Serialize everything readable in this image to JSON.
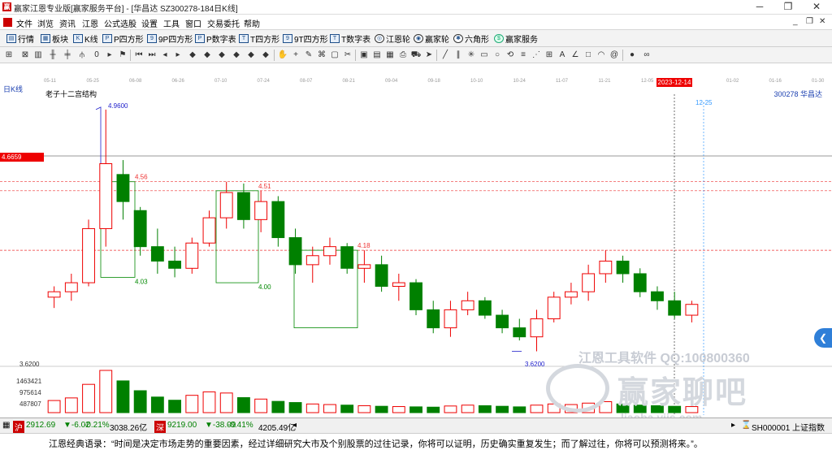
{
  "window": {
    "title": "赢家江恩专业版[赢家服务平台] - [华昌达  SZ300278-184日K线]",
    "controls": [
      "─",
      "❐",
      "✕"
    ]
  },
  "menu": {
    "items": [
      "文件",
      "浏览",
      "资讯",
      "江恩",
      "公式选股",
      "设置",
      "工具",
      "窗口",
      "交易委托",
      "帮助"
    ],
    "right_controls": [
      "_",
      "❐",
      "✕"
    ]
  },
  "toolbar1": {
    "items": [
      {
        "label": "行情",
        "icon": "quote-icon"
      },
      {
        "label": "板块",
        "icon": "sector-icon"
      },
      {
        "label": "K线",
        "icon": "kline-icon"
      },
      {
        "label": "P四方形",
        "icon": "p-square-icon"
      },
      {
        "label": "9P四方形",
        "icon": "9p-square-icon"
      },
      {
        "label": "P数字表",
        "icon": "p-table-icon"
      },
      {
        "label": "T四方形",
        "icon": "t-square-icon"
      },
      {
        "label": "9T四方形",
        "icon": "9t-square-icon"
      },
      {
        "label": "T数字表",
        "icon": "t-table-icon"
      },
      {
        "label": "江恩轮",
        "icon": "gann-wheel-icon"
      },
      {
        "label": "赢家轮",
        "icon": "winner-wheel-icon"
      },
      {
        "label": "六角形",
        "icon": "hexagon-icon"
      },
      {
        "label": "赢家服务",
        "icon": "service-icon"
      }
    ]
  },
  "dates": [
    "05-11",
    "05-25",
    "06-08",
    "06-26",
    "07-10",
    "07-24",
    "08-07",
    "08-21",
    "09-04",
    "09-18",
    "10-10",
    "10-24",
    "11-07",
    "11-21",
    "12-05",
    "2023-12-14",
    "01-02",
    "01-16",
    "01-30"
  ],
  "chart": {
    "period_label": "日K线",
    "structure_label": "老子十二宫结构",
    "code_label": "300278  华昌达",
    "current_price_tag": "4.6659",
    "future_date": "12-25",
    "price_labels": {
      "high": "4.9600",
      "low": "3.6200",
      "l456": "4.56",
      "l451": "4.51",
      "l418": "4.18",
      "l403": "4.03",
      "l400": "4.00"
    },
    "axis_label": "3.6200",
    "volume_axis": [
      "1463421",
      "975614",
      "487807"
    ]
  },
  "chart_data": {
    "type": "candlestick",
    "title": "华昌达 SZ300278 日K线",
    "ohlc": [
      [
        3.92,
        3.98,
        3.86,
        3.95
      ],
      [
        3.95,
        4.05,
        3.9,
        4.0
      ],
      [
        4.0,
        4.35,
        3.98,
        4.3
      ],
      [
        4.3,
        4.96,
        4.2,
        4.66
      ],
      [
        4.6,
        4.68,
        4.35,
        4.45
      ],
      [
        4.4,
        4.42,
        4.15,
        4.2
      ],
      [
        4.2,
        4.3,
        4.05,
        4.12
      ],
      [
        4.12,
        4.2,
        4.03,
        4.08
      ],
      [
        4.08,
        4.25,
        4.05,
        4.22
      ],
      [
        4.22,
        4.4,
        4.2,
        4.36
      ],
      [
        4.36,
        4.56,
        4.3,
        4.5
      ],
      [
        4.5,
        4.55,
        4.3,
        4.35
      ],
      [
        4.35,
        4.51,
        4.28,
        4.45
      ],
      [
        4.45,
        4.48,
        4.2,
        4.25
      ],
      [
        4.25,
        4.3,
        4.05,
        4.1
      ],
      [
        4.1,
        4.2,
        4.0,
        4.15
      ],
      [
        4.15,
        4.25,
        4.1,
        4.2
      ],
      [
        4.2,
        4.22,
        4.05,
        4.08
      ],
      [
        4.08,
        4.18,
        4.0,
        4.1
      ],
      [
        4.1,
        4.15,
        3.95,
        3.98
      ],
      [
        3.98,
        4.05,
        3.9,
        4.0
      ],
      [
        4.0,
        4.02,
        3.82,
        3.85
      ],
      [
        3.85,
        3.9,
        3.72,
        3.75
      ],
      [
        3.75,
        3.9,
        3.7,
        3.85
      ],
      [
        3.85,
        3.95,
        3.82,
        3.9
      ],
      [
        3.9,
        3.92,
        3.8,
        3.82
      ],
      [
        3.82,
        3.85,
        3.72,
        3.75
      ],
      [
        3.75,
        3.8,
        3.68,
        3.7
      ],
      [
        3.7,
        3.85,
        3.62,
        3.8
      ],
      [
        3.8,
        3.95,
        3.78,
        3.92
      ],
      [
        3.92,
        4.0,
        3.88,
        3.95
      ],
      [
        3.95,
        4.1,
        3.9,
        4.05
      ],
      [
        4.05,
        4.18,
        4.0,
        4.12
      ],
      [
        4.12,
        4.15,
        4.0,
        4.05
      ],
      [
        4.05,
        4.08,
        3.92,
        3.95
      ],
      [
        3.95,
        3.98,
        3.85,
        3.9
      ],
      [
        3.9,
        3.95,
        3.8,
        3.82
      ],
      [
        3.82,
        3.9,
        3.78,
        3.88
      ]
    ],
    "volume": [
      420000,
      510000,
      980000,
      1463421,
      1100000,
      760000,
      540000,
      430000,
      600000,
      720000,
      680000,
      520000,
      470000,
      390000,
      350000,
      300000,
      280000,
      260000,
      240000,
      220000,
      210000,
      200000,
      190000,
      230000,
      260000,
      240000,
      220000,
      200000,
      260000,
      300000,
      280000,
      330000,
      380000,
      300000,
      260000,
      240000,
      220000,
      210000
    ],
    "levels": [
      4.56,
      4.51,
      4.18,
      4.03,
      4.0
    ],
    "ylim": [
      3.55,
      5.0
    ]
  },
  "status": {
    "sh_index": "2912.69",
    "sh_change": "▼-6.02",
    "sh_pct": "-0.21%",
    "sh_amount": "3038.26亿",
    "sz_index": "9219.00",
    "sz_change": "▼-38.09",
    "sz_pct": "-0.41%",
    "sz_amount": "4205.49亿",
    "right_label": "SH000001 上证指数"
  },
  "watermark": {
    "line1": "江恩工具软件  QQ:100800360",
    "line2": "赢家聊吧",
    "url": "liaoba.yjjs.com"
  },
  "quote": "江恩经典语录：“时间是决定市场走势的重要因素，经过详细研究大市及个别股票的过往记录，你将可以证明，历史确实重复发生；而了解过往，你将可以预测将来。”。"
}
